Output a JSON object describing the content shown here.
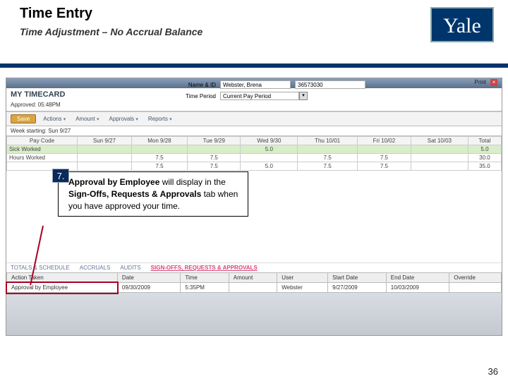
{
  "slide": {
    "title": "Time Entry",
    "subtitle": "Time Adjustment – No Accrual Balance",
    "logo_text": "Yale",
    "page_number": "36"
  },
  "app": {
    "print": "Print",
    "close": "×",
    "section_title": "MY TIMECARD",
    "approved_time": "Approved: 05:48PM",
    "name_id_label": "Name & ID",
    "name_value": "Webster, Brena",
    "id_value": "36573030",
    "period_label": "Time Period",
    "period_value": "Current Pay Period"
  },
  "toolbar": {
    "save": "Save",
    "items": [
      "Actions",
      "Amount",
      "Approvals",
      "Reports"
    ]
  },
  "week_label": "Week starting: Sun 9/27",
  "grid": {
    "headers": [
      "Pay Code",
      "Sun 9/27",
      "Mon 9/28",
      "Tue 9/29",
      "Wed 9/30",
      "Thu 10/01",
      "Fri 10/02",
      "Sat 10/03",
      "Total"
    ],
    "rows": [
      {
        "label": "Sick Worked",
        "cells": [
          "",
          "",
          "",
          "5.0",
          "",
          "",
          "",
          "5.0"
        ],
        "green": true
      },
      {
        "label": "Hours Worked",
        "cells": [
          "",
          "7.5",
          "7.5",
          "",
          "7.5",
          "7.5",
          "",
          "30.0"
        ],
        "green": false
      },
      {
        "label": "",
        "cells": [
          "",
          "7.5",
          "7.5",
          "5.0",
          "7.5",
          "7.5",
          "",
          "35.0"
        ],
        "green": false
      }
    ]
  },
  "callout": {
    "step": "7.",
    "bold1": "Approval by Employee",
    "text1": " will display in the ",
    "bold2": "Sign-Offs, Requests & Approvals",
    "text2": " tab when you have approved your time."
  },
  "tabs": [
    "TOTALS & SCHEDULE",
    "ACCRUALS",
    "AUDITS",
    "SIGN-OFFS, REQUESTS & APPROVALS"
  ],
  "detail": {
    "headers": [
      "Action Taken",
      "Date",
      "Time",
      "Amount",
      "User",
      "Start Date",
      "End Date",
      "Override"
    ],
    "row": [
      "Approval by Employee",
      "09/30/2009",
      "5:35PM",
      "",
      "Webster",
      "9/27/2009",
      "10/03/2009",
      ""
    ]
  }
}
